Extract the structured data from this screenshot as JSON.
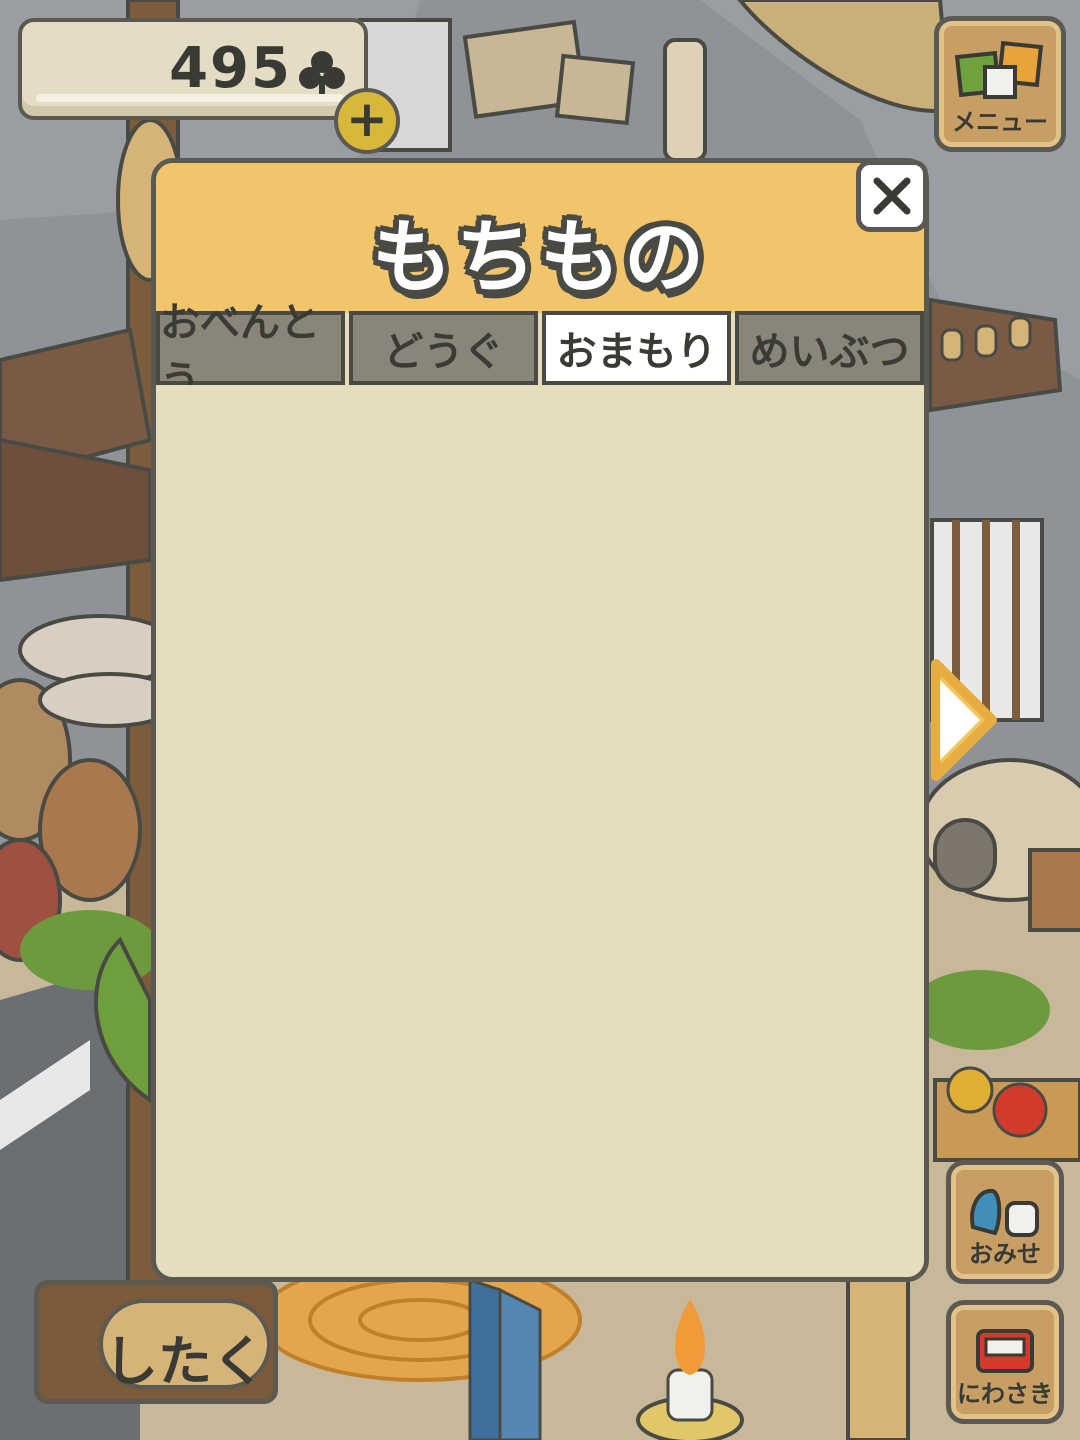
{
  "currency": {
    "count": "495",
    "icon": "clover-icon"
  },
  "panel": {
    "title": "もちもの",
    "tabs": [
      {
        "label": "おべんとう",
        "active": false
      },
      {
        "label": "どうぐ",
        "active": false
      },
      {
        "label": "おまもり",
        "active": true
      },
      {
        "label": "めいぶつ",
        "active": false
      }
    ]
  },
  "side_buttons": {
    "menu_label": "メニュー",
    "shop_label": "おみせ",
    "garden_label": "にわさき"
  },
  "prepare_button": {
    "label": "したく"
  },
  "colors": {
    "panel_header": "#f1c56c",
    "panel_body": "#e6ddbe",
    "tab_inactive": "#898578",
    "tab_active": "#ffffff",
    "outline": "#5a5a52"
  }
}
